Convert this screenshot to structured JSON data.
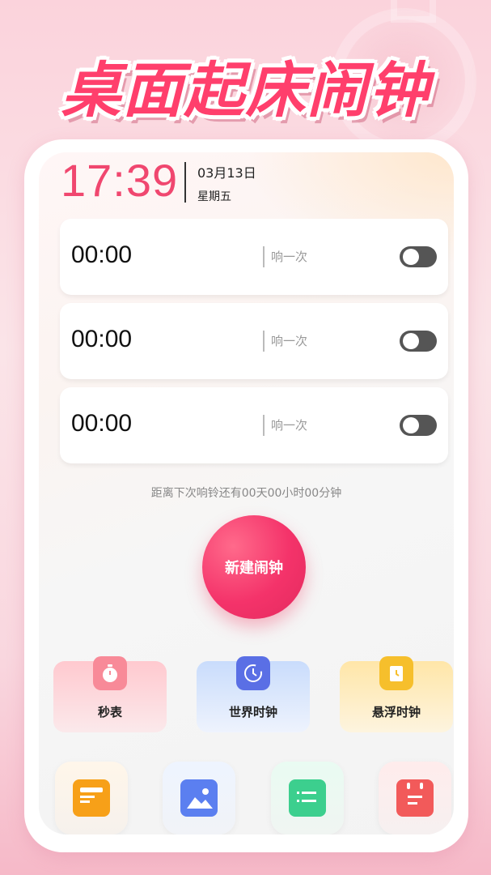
{
  "banner": {
    "title": "桌面起床闹钟"
  },
  "clock": {
    "time": "17:39",
    "date": "03月13日",
    "weekday": "星期五"
  },
  "alarms": [
    {
      "time": "00:00",
      "repeat": "响一次",
      "enabled": false
    },
    {
      "time": "00:00",
      "repeat": "响一次",
      "enabled": false
    },
    {
      "time": "00:00",
      "repeat": "响一次",
      "enabled": false
    }
  ],
  "countdown": "距离下次响铃还有00天00小时00分钟",
  "new_alarm_label": "新建闹钟",
  "tools": [
    {
      "label": "秒表",
      "icon": "stopwatch-icon"
    },
    {
      "label": "世界时钟",
      "icon": "world-clock-icon"
    },
    {
      "label": "悬浮时钟",
      "icon": "floating-clock-icon"
    }
  ],
  "bottom_apps": [
    {
      "icon": "receipt-icon",
      "color": "#f7a018"
    },
    {
      "icon": "image-icon",
      "color": "#5b7ff0"
    },
    {
      "icon": "list-icon",
      "color": "#3ccf8e"
    },
    {
      "icon": "calendar-icon",
      "color": "#f25a5a"
    }
  ],
  "colors": {
    "accent": "#f0476f",
    "button": "#f4336a",
    "toggle_off": "#555555"
  }
}
